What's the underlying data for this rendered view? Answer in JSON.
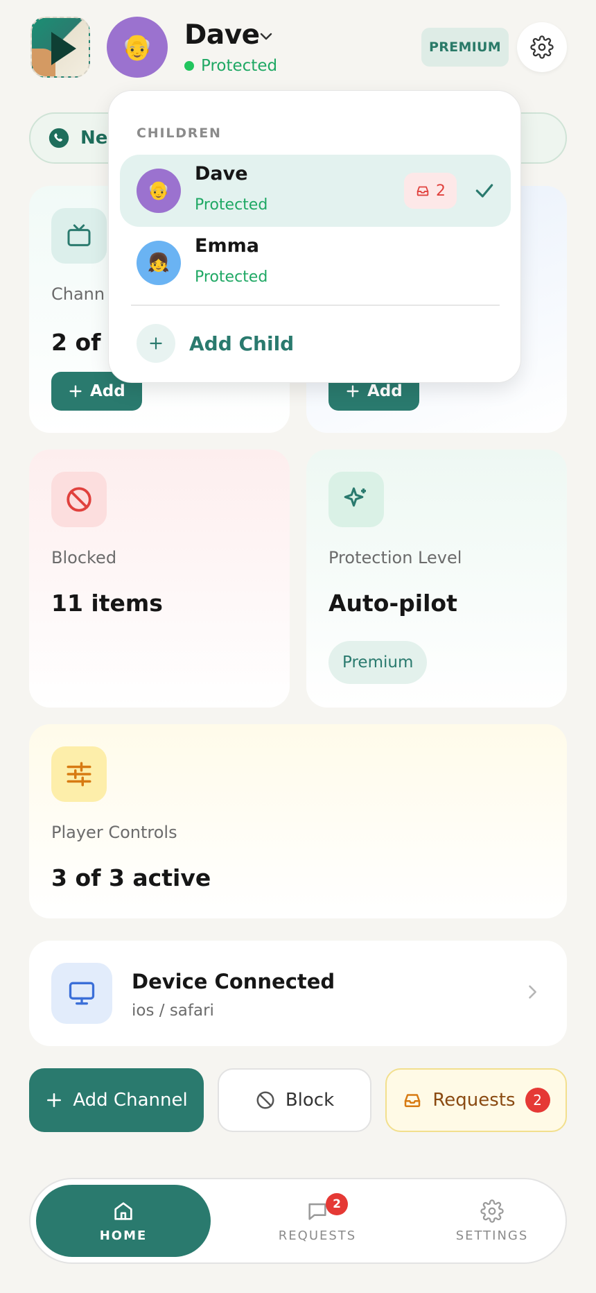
{
  "header": {
    "avatar_emoji": "👴",
    "name": "Dave",
    "status": "Protected",
    "premium_label": "PREMIUM"
  },
  "banner": {
    "text": "Ne"
  },
  "cards": {
    "channels": {
      "label": "Chann",
      "value": "2 of 1",
      "add_label": "Add"
    },
    "second": {
      "add_label": "Add"
    },
    "blocked": {
      "label": "Blocked",
      "value": "11 items"
    },
    "protection": {
      "label": "Protection Level",
      "value": "Auto-pilot",
      "tag": "Premium"
    },
    "player": {
      "label": "Player Controls",
      "value": "3 of 3 active"
    }
  },
  "device": {
    "title": "Device Connected",
    "subtitle": "ios / safari"
  },
  "actions": {
    "add_channel": "Add Channel",
    "block": "Block",
    "requests": "Requests",
    "requests_count": "2"
  },
  "nav": {
    "home": "HOME",
    "requests": "REQUESTS",
    "requests_badge": "2",
    "settings": "SETTINGS"
  },
  "dropdown": {
    "heading": "CHILDREN",
    "children": [
      {
        "name": "Dave",
        "status": "Protected",
        "emoji": "👴",
        "badge_count": "2",
        "selected": true
      },
      {
        "name": "Emma",
        "status": "Protected",
        "emoji": "👧",
        "selected": false
      }
    ],
    "add_child": "Add Child"
  },
  "colors": {
    "accent": "#2a7a6e",
    "protected_green": "#1fa864",
    "badge_red": "#e53935",
    "background": "#f6f5f1"
  }
}
